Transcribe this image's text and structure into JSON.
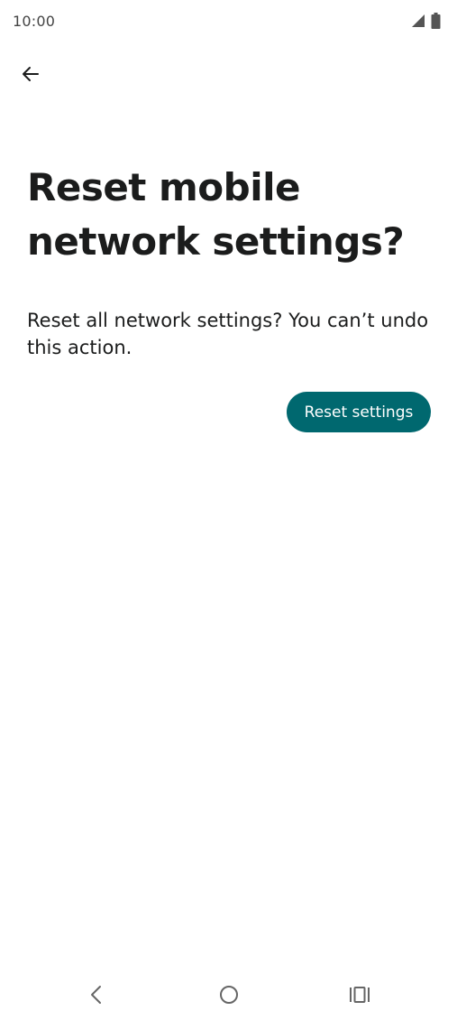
{
  "status_bar": {
    "time": "10:00",
    "icons": [
      "signal-icon",
      "battery-icon"
    ]
  },
  "header": {
    "back_icon": "arrow-back-icon"
  },
  "main": {
    "title": "Reset mobile network settings?",
    "description": "Reset all network settings? You can’t undo this action.",
    "reset_button_label": "Reset settings"
  },
  "nav_bar": {
    "icons": [
      "nav-back-icon",
      "nav-home-icon",
      "nav-recents-icon"
    ]
  },
  "colors": {
    "accent": "#00686f",
    "text": "#1b1c1c",
    "background": "#ffffff"
  }
}
